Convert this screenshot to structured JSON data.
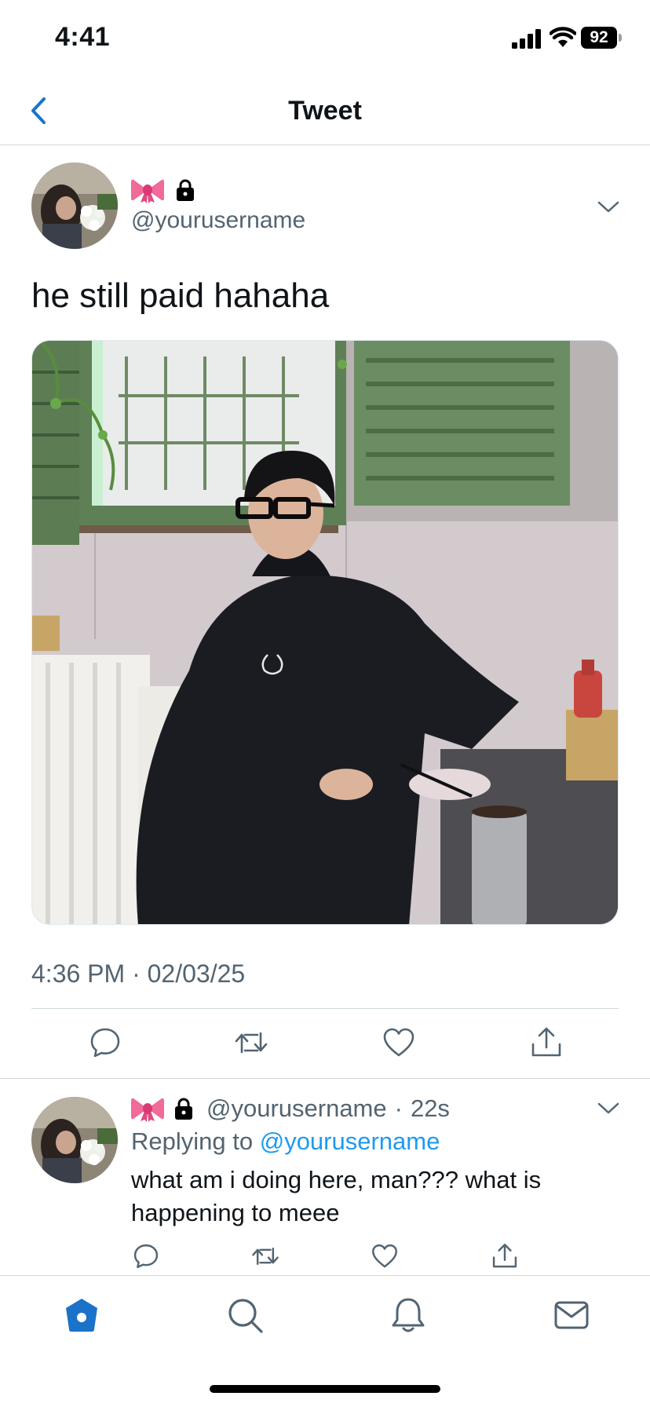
{
  "status_bar": {
    "time": "4:41",
    "battery": "92"
  },
  "nav": {
    "title": "Tweet"
  },
  "tweet": {
    "handle": "@yourusername",
    "text": "he still paid hahaha",
    "timestamp": "4:36 PM · 02/03/25"
  },
  "reply": {
    "handle": "@yourusername",
    "separator": "·",
    "age": "22s",
    "replying_prefix": "Replying to",
    "replying_handle": "@yourusername",
    "text": "what am i doing here, man??? what is happening to meee"
  },
  "icons": {
    "brand_blue": "#1d9bf0",
    "nav_blue": "#1a73c8",
    "muted": "#536471",
    "tabs": [
      "home-icon",
      "search-icon",
      "bell-icon",
      "mail-icon"
    ],
    "actions": [
      "reply-icon",
      "retweet-icon",
      "like-icon",
      "share-icon"
    ]
  }
}
